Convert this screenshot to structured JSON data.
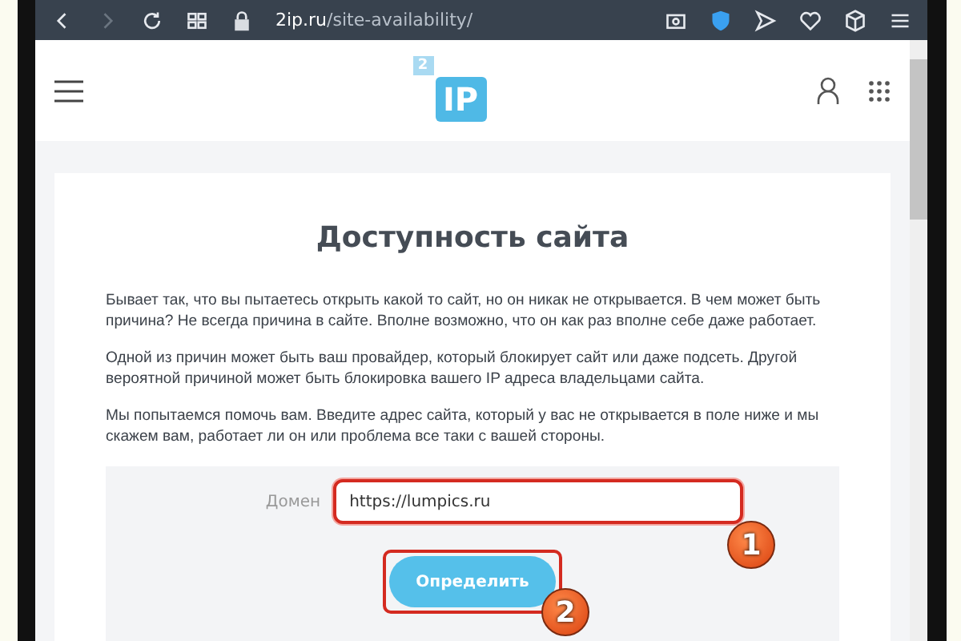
{
  "browser": {
    "address_host": "2ip.ru",
    "address_path": "/site-availability/"
  },
  "header": {
    "logo_small": "2",
    "logo_main": "IP"
  },
  "page": {
    "title": "Доступность сайта",
    "paragraphs": [
      "Бывает так, что вы пытаетесь открыть какой то сайт, но он никак не открывается. В чем может быть причина? Не всегда причина в сайте. Вполне возможно, что он как раз вполне себе даже работает.",
      "Одной из причин может быть ваш провайдер, который блокирует сайт или даже подсеть. Другой вероятной причиной может быть блокировка вашего IP адреса владельцами сайта.",
      "Мы попытаемся помочь вам. Введите адрес сайта, который у вас не открывается в поле ниже и мы скажем вам, работает ли он или проблема все таки с вашей стороны."
    ],
    "form": {
      "label": "Домен",
      "value": "https://lumpics.ru",
      "button": "Определить"
    }
  },
  "annotations": [
    "1",
    "2"
  ]
}
